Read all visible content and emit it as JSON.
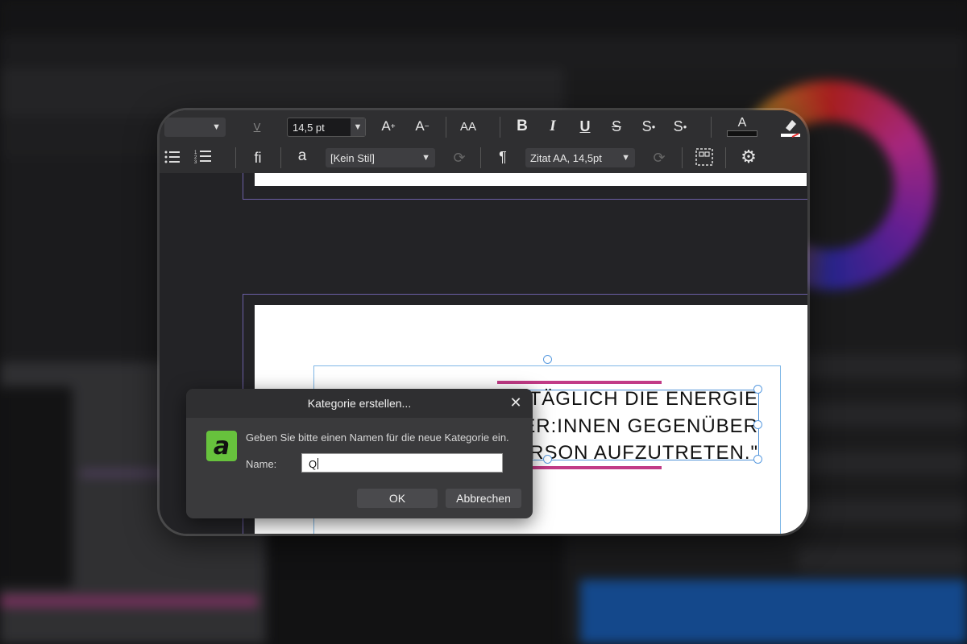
{
  "toolbar_row1": {
    "font_size_value": "14,5 pt",
    "case_label": "AA",
    "bold_label": "B",
    "italic_label": "I",
    "underline_label": "U",
    "strike_label": "S",
    "superscript_label": "S",
    "subscript_label": "S",
    "text_color_label": "A",
    "tracking_label": "V"
  },
  "toolbar_row2": {
    "ligature_label": "fi",
    "char_style_icon_label": "a",
    "char_style_value": "[Kein Stil]",
    "paragraph_mark": "¶",
    "paragraph_style_value": "Zitat AA, 14,5pt"
  },
  "document": {
    "quote_line1": "TÄGLICH DIE ENERGIE",
    "quote_line2": "ER:INNEN GEGENÜBER",
    "quote_line3": "ALS FÜHRUNGSPERSON AUFZUTRETEN.\""
  },
  "dialog": {
    "title": "Kategorie erstellen...",
    "close_symbol": "✕",
    "prompt": "Geben Sie bitte einen Namen für die neue Kategorie ein.",
    "name_label": "Name:",
    "name_value": "Q",
    "ok_label": "OK",
    "cancel_label": "Abbrechen"
  },
  "colors": {
    "accent_pink": "#c23b86",
    "selection_blue": "#4b8fd6",
    "logo_green": "#67c23d"
  }
}
